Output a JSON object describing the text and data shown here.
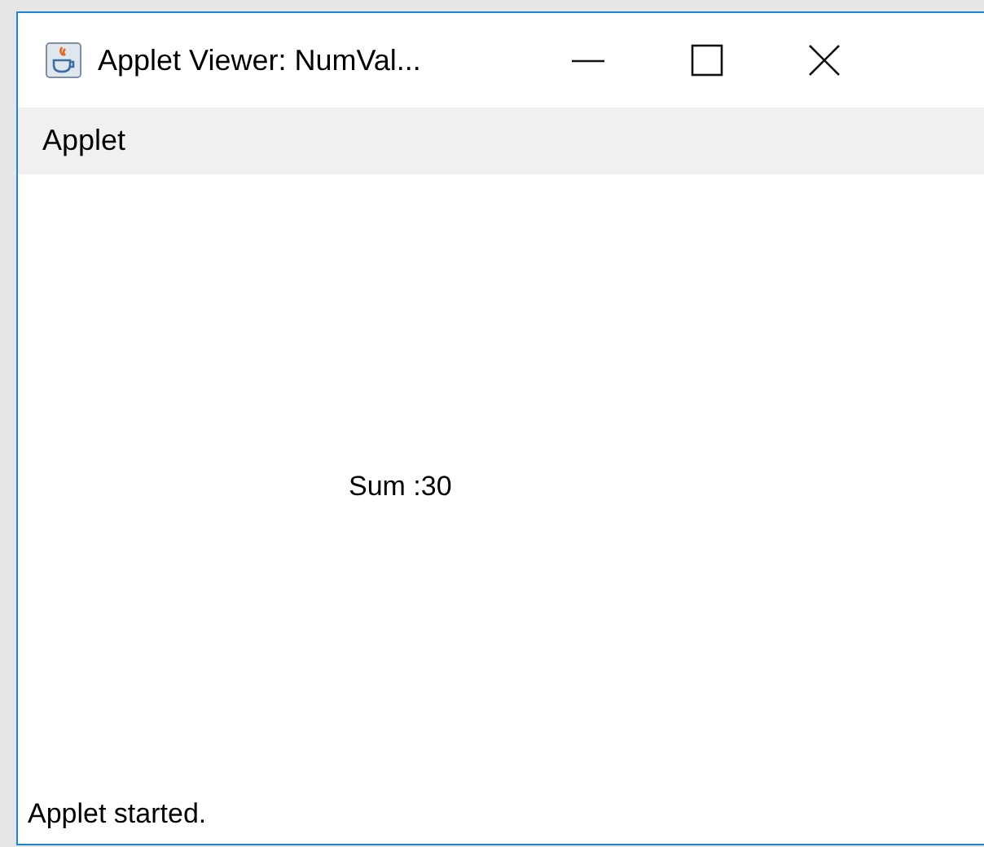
{
  "window": {
    "title": "Applet Viewer: NumVal..."
  },
  "menu_bar": {
    "items": [
      "Applet"
    ]
  },
  "applet": {
    "text": "Sum :30"
  },
  "status_bar": {
    "text": "Applet started."
  }
}
